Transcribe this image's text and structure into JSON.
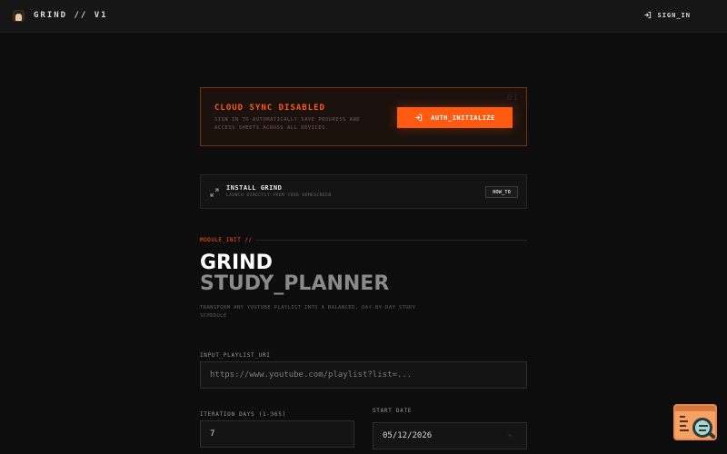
{
  "header": {
    "brand": "GRIND // V1",
    "signin_label": "SIGN_IN"
  },
  "cloud_sync": {
    "title": "CLOUD SYNC DISABLED",
    "description": "SIGN IN TO AUTOMATICALLY SAVE PROGRESS AND ACCESS SHEETS ACROSS ALL DEVICES.",
    "decoration": "01",
    "button_label": "AUTH_INITIALIZE"
  },
  "install": {
    "title": "INSTALL GRIND",
    "subtitle": "LAUNCH DIRECTLY FROM YOUR HOMESCREEN",
    "button_label": "HOW_TO"
  },
  "module": {
    "label": "MODULE_INIT //",
    "title_line1": "GRIND",
    "title_line2": "STUDY_PLANNER",
    "tagline": "TRANSFORM ANY YOUTUBE PLAYLIST INTO A BALANCED, DAY-BY-DAY STUDY SCHEDULE"
  },
  "form": {
    "playlist_label": "INPUT_PLAYLIST_URI",
    "playlist_placeholder": "https://www.youtube.com/playlist?list=...",
    "playlist_value": "",
    "days_label": "ITERATION DAYS (1-365)",
    "days_value": "7",
    "start_label": "START DATE",
    "start_value": "05/12/2026"
  },
  "colors": {
    "accent": "#ff5a12",
    "background": "#0d0d0d",
    "card_border": "#7a2e0e"
  },
  "icons": {
    "signin": "login-arrow-icon",
    "auth": "login-arrow-icon",
    "install": "expand-arrows-icon",
    "widget": "document-search-icon"
  }
}
